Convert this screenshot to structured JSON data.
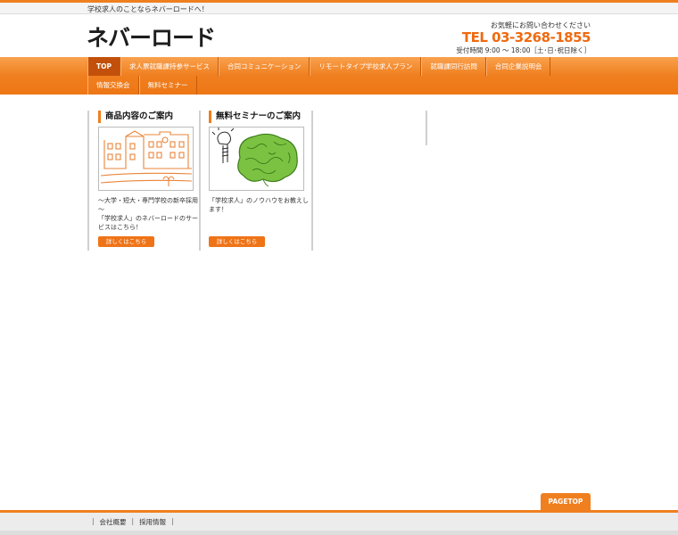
{
  "topbar": {
    "tagline": "学校求人のことならネバーロードへ！"
  },
  "header": {
    "logo": "ネバーロード",
    "contact_note": "お気軽にお問い合わせください",
    "tel": "TEL 03-3268-1855",
    "hours": "受付時間 9:00 ～ 18:00［土･日･祝日除く］"
  },
  "nav": {
    "row1": [
      {
        "label": "TOP"
      },
      {
        "label": "求人票就職課持参サービス"
      },
      {
        "label": "合同コミュニケーション"
      },
      {
        "label": "リモートタイプ学校求人プラン"
      },
      {
        "label": "就職課同行訪問"
      },
      {
        "label": "合同企業説明会"
      }
    ],
    "row2": [
      {
        "label": "情報交換会"
      },
      {
        "label": "無料セミナー"
      }
    ]
  },
  "cards": [
    {
      "heading": "商品内容のご案内",
      "line1": "～大学・短大・専門学校の新卒採用～",
      "line2": "「学校求人」のネバーロードのサービスはこちら！",
      "button": "詳しくはこちら"
    },
    {
      "heading": "無料セミナーのご案内",
      "line1": "「学校求人」のノウハウをお教えします！",
      "line2": "",
      "button": "詳しくはこちら"
    }
  ],
  "pagetop": "PAGETOP",
  "footer": {
    "links": [
      "会社概要",
      "採用情報"
    ]
  },
  "colors": {
    "accent": "#f07f1f",
    "nav_active": "#c2500a",
    "text": "#333333"
  }
}
